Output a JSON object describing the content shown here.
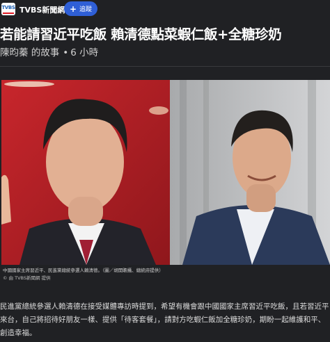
{
  "source": {
    "logo_text": "TVBS",
    "name": "TVBS新聞網",
    "follow_label": "追蹤"
  },
  "article": {
    "headline": "若能請習近平吃飯 賴清德點菜蝦仁飯+全糖珍奶",
    "author": "陳昀蓁 的故事",
    "time": "6 小時",
    "photo": {
      "caption": "中國國家主席習近平、民進黨總統參選人賴清德。（圖／胡開瞻攝、總統府提供）",
      "credit": "© 由 TVBS新聞網 提供"
    },
    "body_lines": [
      "民進黨總統參選人賴清德在接受媒體專訪時提到，希望有機會跟中國國家主席習近平吃飯，且若習近平",
      "來台，自己將招待好朋友一樣、提供「待客套餐」，請對方吃蝦仁飯加全糖珍奶，期盼一起維護和平、",
      "創造幸福。"
    ]
  },
  "colors": {
    "background": "#202124",
    "follow_button": "#2f5fd6",
    "photo_left_bg": "#b8232a",
    "photo_right_bg": "#b9bbbd"
  }
}
